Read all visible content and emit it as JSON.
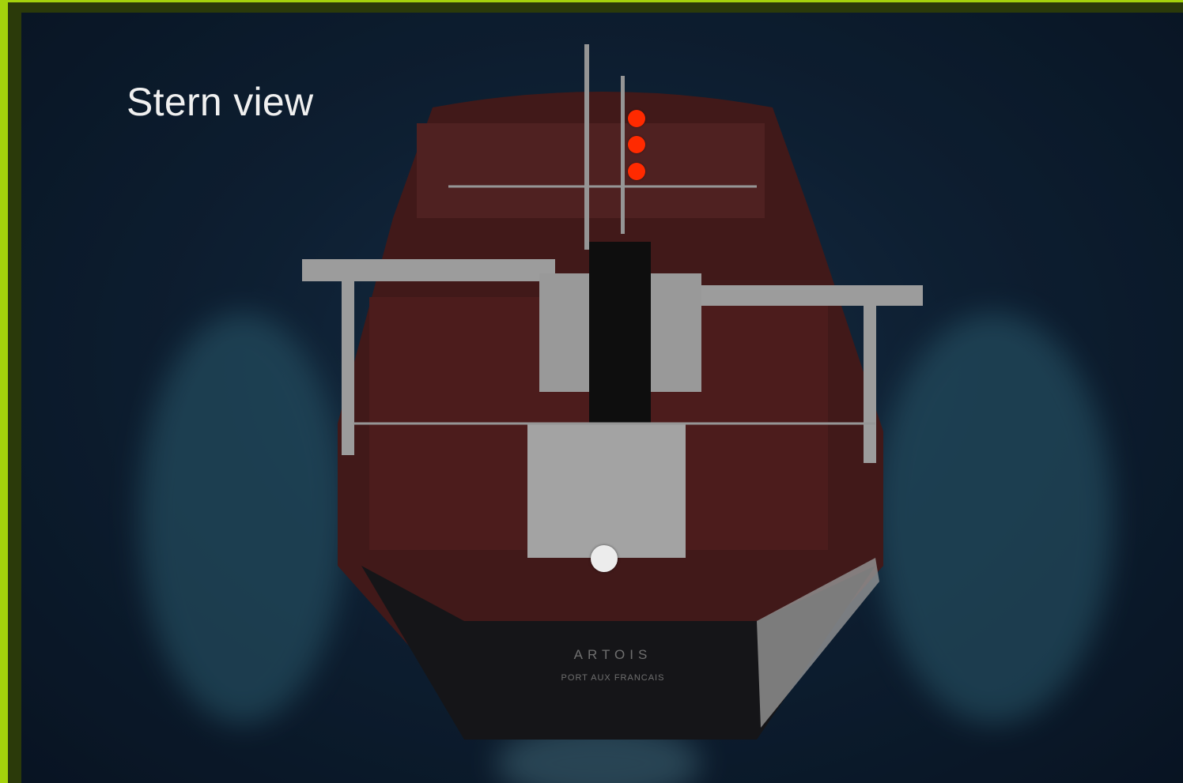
{
  "viewer": {
    "title": "Stern view",
    "ship_name": "ARTOIS",
    "home_port": "PORT AUX FRANCAIS"
  },
  "markers": {
    "red": [
      "hotspot-1",
      "hotspot-2",
      "hotspot-3"
    ],
    "white": [
      "hotspot-current"
    ]
  },
  "colors": {
    "frame": "#a4d20c",
    "marker_red": "#ff2a00",
    "marker_white": "#ececec",
    "sea": "#132b45",
    "deck": "#6a2a2a"
  }
}
